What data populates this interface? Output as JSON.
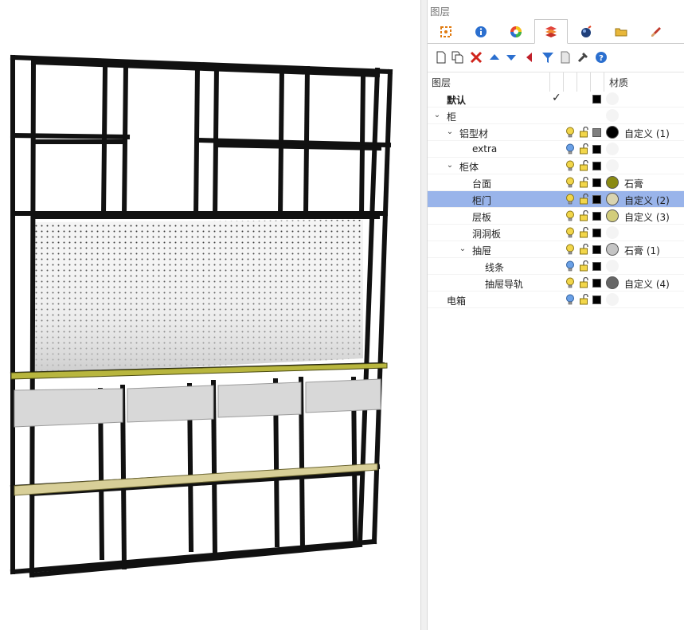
{
  "panel": {
    "title": "图层",
    "tabs": [
      {
        "name": "objects-tab",
        "icon": "objects-icon"
      },
      {
        "name": "properties-tab",
        "icon": "info-icon"
      },
      {
        "name": "render-tab",
        "icon": "color-wheel-icon"
      },
      {
        "name": "layers-tab",
        "icon": "layers-icon",
        "active": true
      },
      {
        "name": "display-tab",
        "icon": "sphere-icon"
      },
      {
        "name": "files-tab",
        "icon": "folder-icon"
      },
      {
        "name": "materials-tab",
        "icon": "brush-icon"
      }
    ],
    "toolbar": [
      "new-layer-icon",
      "new-sublayer-icon",
      "delete-icon",
      "move-up-icon",
      "move-down-icon",
      "move-to-parent-icon",
      "filter-icon",
      "layer-page-icon",
      "tools-icon",
      "help-icon"
    ],
    "columns": {
      "layer": "图层",
      "material": "材质"
    },
    "layers": [
      {
        "name": "默认",
        "indent": 0,
        "bold": true,
        "current": true,
        "check": "✓",
        "bulb": "yellow",
        "color": "#000000",
        "material": null
      },
      {
        "name": "柜",
        "indent": 0,
        "expanded": true,
        "color": null,
        "material": null
      },
      {
        "name": "铝型材",
        "indent": 1,
        "expanded": true,
        "bulb": "yellow",
        "color": "#808080",
        "material": {
          "dot": "#000000",
          "label": "自定义 (1)"
        }
      },
      {
        "name": "extra",
        "indent": 2,
        "bulb": "blue",
        "color": "#000000",
        "material": null
      },
      {
        "name": "柜体",
        "indent": 1,
        "expanded": true,
        "bulb": "yellow",
        "color": "#000000",
        "material": null
      },
      {
        "name": "台面",
        "indent": 2,
        "bulb": "yellow",
        "color": "#000000",
        "material": {
          "dot": "#8a8a12",
          "label": "石膏"
        }
      },
      {
        "name": "柜门",
        "indent": 2,
        "selected": true,
        "bulb": "yellow",
        "color": "#000000",
        "material": {
          "dot": "#d9d4b0",
          "label": "自定义 (2)"
        }
      },
      {
        "name": "层板",
        "indent": 2,
        "bulb": "yellow",
        "color": "#000000",
        "material": {
          "dot": "#d3cd7c",
          "label": "自定义 (3)"
        }
      },
      {
        "name": "洞洞板",
        "indent": 2,
        "bulb": "yellow",
        "color": "#000000",
        "material": null
      },
      {
        "name": "抽屉",
        "indent": 2,
        "expanded": true,
        "bulb": "yellow",
        "color": "#000000",
        "material": {
          "dot": "#c4c4c4",
          "label": "石膏 (1)"
        }
      },
      {
        "name": "线条",
        "indent": 3,
        "bulb": "blue",
        "color": "#000000",
        "material": null
      },
      {
        "name": "抽屉导轨",
        "indent": 3,
        "bulb": "yellow",
        "color": "#000000",
        "material": {
          "dot": "#666666",
          "label": "自定义 (4)"
        }
      },
      {
        "name": "电箱",
        "indent": 0,
        "bulb": "blue",
        "color": "#000000",
        "material": null
      }
    ]
  },
  "colors": {
    "selection": "#99b4ea",
    "frame": "#111111",
    "countertop": "#c2c050",
    "shelf": "#d8cf98",
    "drawer": "#d8d8d8"
  }
}
